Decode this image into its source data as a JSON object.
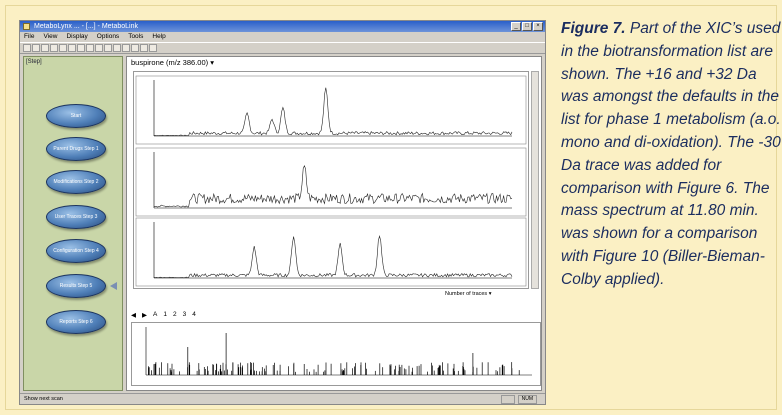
{
  "window": {
    "title": "MetaboLynx ... - [...] - MetaboLink",
    "menu": [
      "File",
      "View",
      "Display",
      "Options",
      "Tools",
      "Help"
    ]
  },
  "sidebar": {
    "tab_label": "[Step]",
    "steps": [
      {
        "label": "Start"
      },
      {
        "label": "Parent Drugs Step 1"
      },
      {
        "label": "Modifications Step 2"
      },
      {
        "label": "User Traces Step 3"
      },
      {
        "label": "Configuration Step 4"
      },
      {
        "label": "Results Step 5",
        "active": true
      },
      {
        "label": "Reports Step 6"
      }
    ]
  },
  "main": {
    "dataset_label": "buspirone (m/z 386.00)",
    "traces_label": "Number of traces",
    "spectrum_tabs": [
      "A",
      "1",
      "2",
      "3",
      "4"
    ]
  },
  "statusbar": {
    "text": "Show next scan",
    "cells": [
      "NUM"
    ]
  },
  "caption": {
    "heading": "Figure 7.",
    "text": "Part of the XIC’s used in the biotransformation list are shown. The +16 and +32 Da was amongst the defaults in the list for phase 1 metabolism (a.o. mono and di-oxidation). The -30 Da trace was added for comparison with Figure 6. The mass spectrum at 11.80 min. was shown for a comparison with Figure 10 (Biller-Bieman-Colby applied)."
  },
  "colors": {
    "background": "#fbf0c4",
    "caption": "#1b2d5f",
    "sidebar": "#c9d6a8",
    "step_button": "#4f7fb8"
  }
}
